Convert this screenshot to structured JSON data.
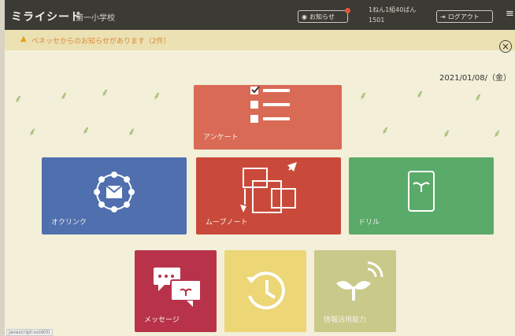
{
  "header": {
    "logo": "ミライシード",
    "school": "第一小学校",
    "notice_label": "お知らせ",
    "user_name": "1ねん1組40ばん",
    "user_id": "1501",
    "logout_label": "ログアウト"
  },
  "alert": {
    "message": "ベネッセからのお知らせがあります（2件）"
  },
  "date": "2021/01/08/（金）",
  "tiles": {
    "survey": "アンケート",
    "okuring": "オクリンク",
    "middle": "ムーブノート",
    "tablet": "ドリル",
    "message": "メッセージ",
    "history": "",
    "growth": "情報活用能力"
  },
  "footer": {
    "status": "javascript:void(0)"
  },
  "colors": {
    "topbar": "#3b3a35",
    "survey": "#d96a55",
    "okuring": "#4f6fae",
    "middle": "#c94a3a",
    "tablet": "#5aaa6a",
    "message": "#b8334a",
    "history": "#ecd676",
    "growth": "#c9c98a"
  }
}
